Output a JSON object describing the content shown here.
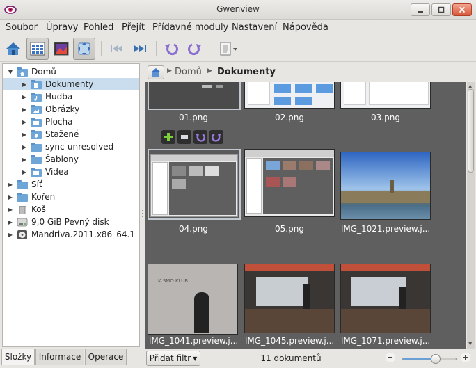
{
  "window": {
    "title": "Gwenview"
  },
  "menu": [
    "Soubor",
    "Úpravy",
    "Pohled",
    "Přejít",
    "Přídavné moduly",
    "Nastavení",
    "Nápověda"
  ],
  "sidebar": {
    "items": [
      {
        "label": "Domů",
        "level": 0,
        "expanded": true
      },
      {
        "label": "Dokumenty",
        "level": 1,
        "selected": true
      },
      {
        "label": "Hudba",
        "level": 1
      },
      {
        "label": "Obrázky",
        "level": 1
      },
      {
        "label": "Plocha",
        "level": 1
      },
      {
        "label": "Stažené",
        "level": 1
      },
      {
        "label": "sync-unresolved",
        "level": 1
      },
      {
        "label": "Šablony",
        "level": 1
      },
      {
        "label": "Videa",
        "level": 1
      },
      {
        "label": "Síť",
        "level": 0
      },
      {
        "label": "Kořen",
        "level": 0
      },
      {
        "label": "Koš",
        "level": 0
      },
      {
        "label": "9,0 GiB Pevný disk",
        "level": 0
      },
      {
        "label": "Mandriva.2011.x86_64.1",
        "level": 0
      }
    ],
    "tabs": [
      "Složky",
      "Informace",
      "Operace"
    ]
  },
  "breadcrumb": {
    "items": [
      "Domů",
      "Dokumenty"
    ]
  },
  "thumbnails": [
    {
      "caption": "01.png"
    },
    {
      "caption": "02.png"
    },
    {
      "caption": "03.png"
    },
    {
      "caption": "04.png"
    },
    {
      "caption": "05.png"
    },
    {
      "caption": "IMG_1021.preview.j..."
    },
    {
      "caption": "IMG_1041.preview.j..."
    },
    {
      "caption": "IMG_1045.preview.j..."
    },
    {
      "caption": "IMG_1071.preview.j..."
    }
  ],
  "photo_text": {
    "kosmo": "K  SMO KLUB"
  },
  "status": {
    "filter_label": "Přidat filtr",
    "count": "11 dokumentů",
    "zoom_fraction": 0.6
  },
  "colors": {
    "selection": "#c9ddef",
    "grid_bg": "#5f5f5f",
    "folder": "#6fa6d8"
  }
}
